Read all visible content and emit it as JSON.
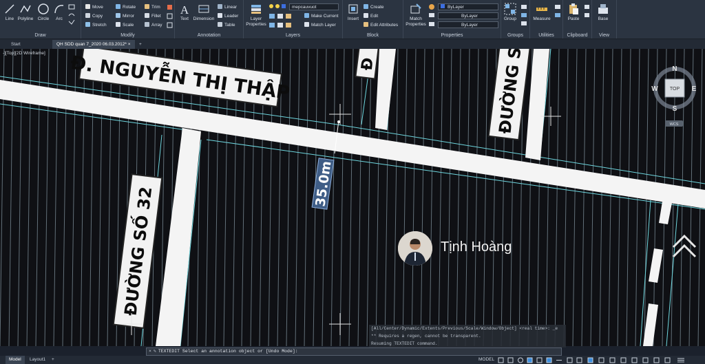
{
  "ribbon": {
    "draw": {
      "label": "Draw",
      "line": "Line",
      "polyline": "Polyline",
      "circle": "Circle",
      "arc": "Arc"
    },
    "modify": {
      "label": "Modify",
      "move": "Move",
      "rotate": "Rotate",
      "trim": "Trim",
      "copy": "Copy",
      "mirror": "Mirror",
      "fillet": "Fillet",
      "stretch": "Stretch",
      "scale": "Scale",
      "array": "Array"
    },
    "annotation": {
      "label": "Annotation",
      "text": "Text",
      "dimension": "Dimension",
      "linear": "Linear",
      "leader": "Leader",
      "table": "Table"
    },
    "layers": {
      "label": "Layers",
      "layer_properties": "Layer Properties",
      "current_layer": "mepcauvuot",
      "make_current": "Make Current",
      "match_layer": "Match Layer"
    },
    "block": {
      "label": "Block",
      "insert": "Insert",
      "create": "Create",
      "edit": "Edit",
      "edit_attributes": "Edit Attributes"
    },
    "properties": {
      "label": "Properties",
      "match_properties": "Match Properties",
      "color": "ByLayer",
      "linetype": "ByLayer",
      "lineweight": "ByLayer"
    },
    "groups": {
      "label": "Groups",
      "group": "Group"
    },
    "utilities": {
      "label": "Utilities",
      "measure": "Measure"
    },
    "clipboard": {
      "label": "Clipboard",
      "paste": "Paste"
    },
    "view": {
      "label": "View",
      "base": "Base"
    }
  },
  "tabs": {
    "start": "Start",
    "drawing": "QH SDD quan 7_2020 06.03.2012*",
    "add": "+"
  },
  "viewport": {
    "label": "-][Top][2D Wireframe]",
    "street_1": "Đ. NGUYỄN THỊ THẬP",
    "street_2": "ĐƯỜNG SỐ 32",
    "street_3": "ĐƯỜNG SỐ",
    "street_4": "Đ",
    "dimension": "35.0m",
    "viewcube": {
      "n": "N",
      "e": "E",
      "s": "S",
      "w": "W",
      "top": "TOP",
      "wcs": "WCS"
    }
  },
  "presenter": {
    "name": "Tịnh Hoàng"
  },
  "command": {
    "history": [
      "[All/Center/Dynamic/Extents/Previous/Scale/Window/Object] <real time>: _e",
      "** Requires a regen, cannot be transparent.",
      "Resuming TEXTEDIT command."
    ],
    "prompt": "TEXTEDIT Select an annotation object or [Undo Mode]:"
  },
  "status": {
    "model_tab": "Model",
    "layout_tab": "Layout1",
    "add": "+",
    "mode": "MODEL"
  }
}
